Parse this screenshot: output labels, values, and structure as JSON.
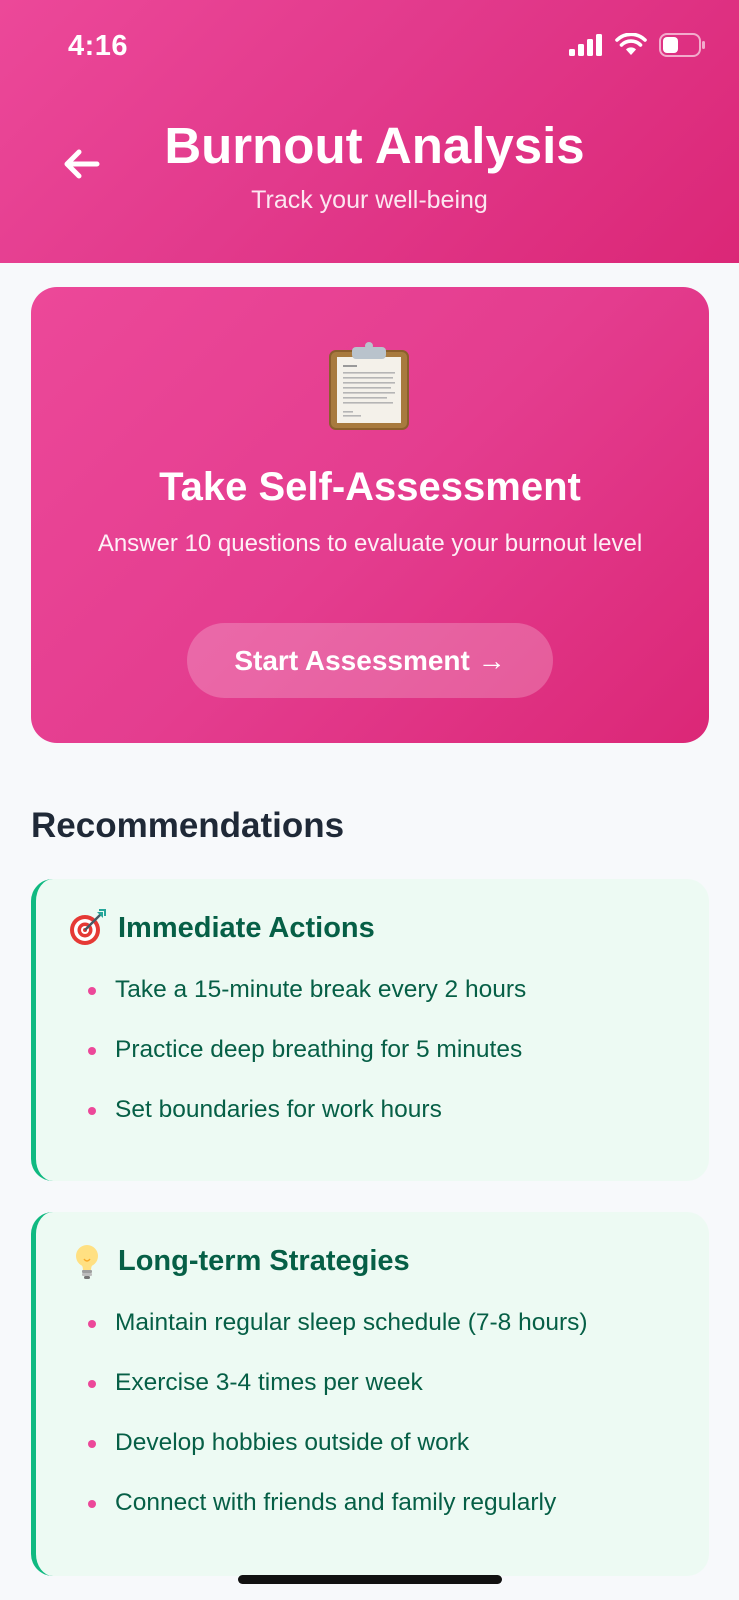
{
  "status_bar": {
    "time": "4:16",
    "icons": [
      "cellular-signal-icon",
      "wifi-icon",
      "battery-icon"
    ],
    "battery_level": 0.45
  },
  "header": {
    "title": "Burnout Analysis",
    "subtitle": "Track your well-being",
    "back_icon": "arrow-left-icon",
    "gradient_colors": [
      "#ec4899",
      "#db2777"
    ]
  },
  "assessment": {
    "icon": "clipboard-icon",
    "title": "Take Self-Assessment",
    "description": "Answer 10 questions to evaluate your burnout level",
    "button_label": "Start Assessment →"
  },
  "recommendations": {
    "heading": "Recommendations",
    "accent_color": "#10b981",
    "bullet_color": "#ec4899",
    "sections": [
      {
        "icon": "target-icon",
        "title": "Immediate Actions",
        "items": [
          "Take a 15-minute break every 2 hours",
          "Practice deep breathing for 5 minutes",
          "Set boundaries for work hours"
        ]
      },
      {
        "icon": "light-bulb-icon",
        "title": "Long-term Strategies",
        "items": [
          "Maintain regular sleep schedule (7-8 hours)",
          "Exercise 3-4 times per week",
          "Develop hobbies outside of work",
          "Connect with friends and family regularly"
        ]
      }
    ]
  }
}
